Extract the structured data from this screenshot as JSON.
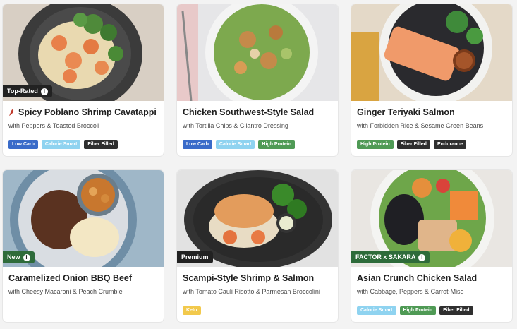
{
  "cards": [
    {
      "title": "Spicy Poblano Shrimp Cavatappi",
      "subtitle": "with Peppers & Toasted Broccoli",
      "flag": "Top-Rated",
      "spicy_icon": "chili-pepper-icon",
      "tags": [
        "Low Carb",
        "Calorie Smart",
        "Fiber Filled"
      ]
    },
    {
      "title": "Chicken Southwest-Style Salad",
      "subtitle": "with Tortilla Chips & Cilantro Dressing",
      "tags": [
        "Low Carb",
        "Calorie Smart",
        "High Protein"
      ]
    },
    {
      "title": "Ginger Teriyaki Salmon",
      "subtitle": "with Forbidden Rice & Sesame Green Beans",
      "tags": [
        "High Protein",
        "Fiber Filled",
        "Endurance"
      ]
    },
    {
      "title": "Caramelized Onion BBQ Beef",
      "subtitle": "with Cheesy Macaroni & Peach Crumble",
      "flag": "New",
      "tags": []
    },
    {
      "title": "Scampi-Style Shrimp & Salmon",
      "subtitle": "with Tomato Cauli Risotto & Parmesan Broccolini",
      "flag": "Premium",
      "tags": [
        "Keto"
      ]
    },
    {
      "title": "Asian Crunch Chicken Salad",
      "subtitle": "with Cabbage, Peppers & Carrot-Miso",
      "flag": "FACTOR x SAKARA",
      "tags": [
        "Calorie Smart",
        "High Protein",
        "Fiber Filled"
      ]
    }
  ],
  "tag_colors": {
    "Low Carb": "#3a6bc9",
    "Calorie Smart": "#8fd3f0",
    "Fiber Filled": "#2f2f2f",
    "High Protein": "#4f9a55",
    "Endurance": "#2f2f2f",
    "Keto": "#f2c94c"
  },
  "info_icon_glyph": "i"
}
